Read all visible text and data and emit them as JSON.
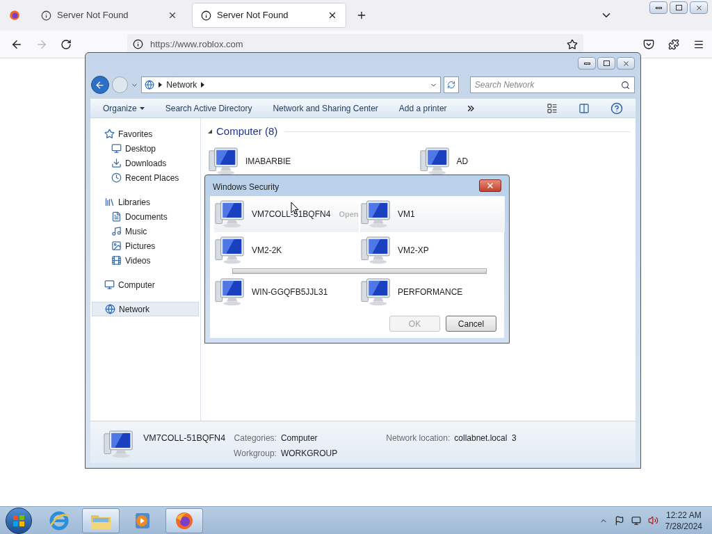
{
  "browser": {
    "tabs": [
      {
        "title": "Server Not Found",
        "selected": false
      },
      {
        "title": "Server Not Found",
        "selected": true
      }
    ],
    "url": "https://www.roblox.com"
  },
  "explorer": {
    "breadcrumb": "Network",
    "search": {
      "placeholder": "Search Network"
    },
    "toolbar": [
      "Organize",
      "Search Active Directory",
      "Network and Sharing Center",
      "Add a printer"
    ],
    "nav": [
      {
        "label": "Favorites",
        "selected": false,
        "children": [
          {
            "label": "Desktop",
            "selected": false
          },
          {
            "label": "Downloads",
            "selected": false
          },
          {
            "label": "Recent Places",
            "selected": false
          }
        ]
      },
      {
        "label": "Libraries",
        "selected": false,
        "children": [
          {
            "label": "Documents",
            "selected": false
          },
          {
            "label": "Music",
            "selected": false
          },
          {
            "label": "Pictures",
            "selected": false
          },
          {
            "label": "Videos",
            "selected": false
          }
        ]
      },
      {
        "label": "Computer",
        "selected": false
      },
      {
        "label": "Network",
        "selected": true
      }
    ],
    "group_title": "Computer (8)",
    "computers": [
      {
        "name": "IMABARBIE",
        "selected": false
      },
      {
        "name": "AD",
        "selected": false
      }
    ],
    "details": {
      "name": "VM7COLL-51BQFN4",
      "fields": [
        {
          "label": "Categories:",
          "value": "Computer"
        },
        {
          "label": "Workgroup:",
          "value": "WORKGROUP"
        },
        {
          "label": "Network location:",
          "value": "collabnet.local  3"
        }
      ]
    }
  },
  "dialog": {
    "title": "Windows Security",
    "computers": [
      {
        "name": "VM7COLL-51BQFN4",
        "selected": true
      },
      {
        "name": "VM1",
        "selected": true
      },
      {
        "name": "VM2-2K",
        "selected": false
      },
      {
        "name": "VM2-XP",
        "selected": false
      },
      {
        "name": "WIN-GGQFB5JJL31",
        "selected": false
      },
      {
        "name": "PERFORMANCE",
        "selected": false
      }
    ],
    "ghost_label": "Open",
    "buttons": [
      {
        "label": "OK",
        "disabled": true
      },
      {
        "label": "Cancel",
        "disabled": false
      }
    ]
  },
  "taskbar": {
    "apps": [
      {
        "selected": false
      },
      {
        "selected": true
      },
      {
        "selected": false
      },
      {
        "selected": true
      }
    ],
    "time": "12:22 AM",
    "date": "7/28/2024"
  }
}
